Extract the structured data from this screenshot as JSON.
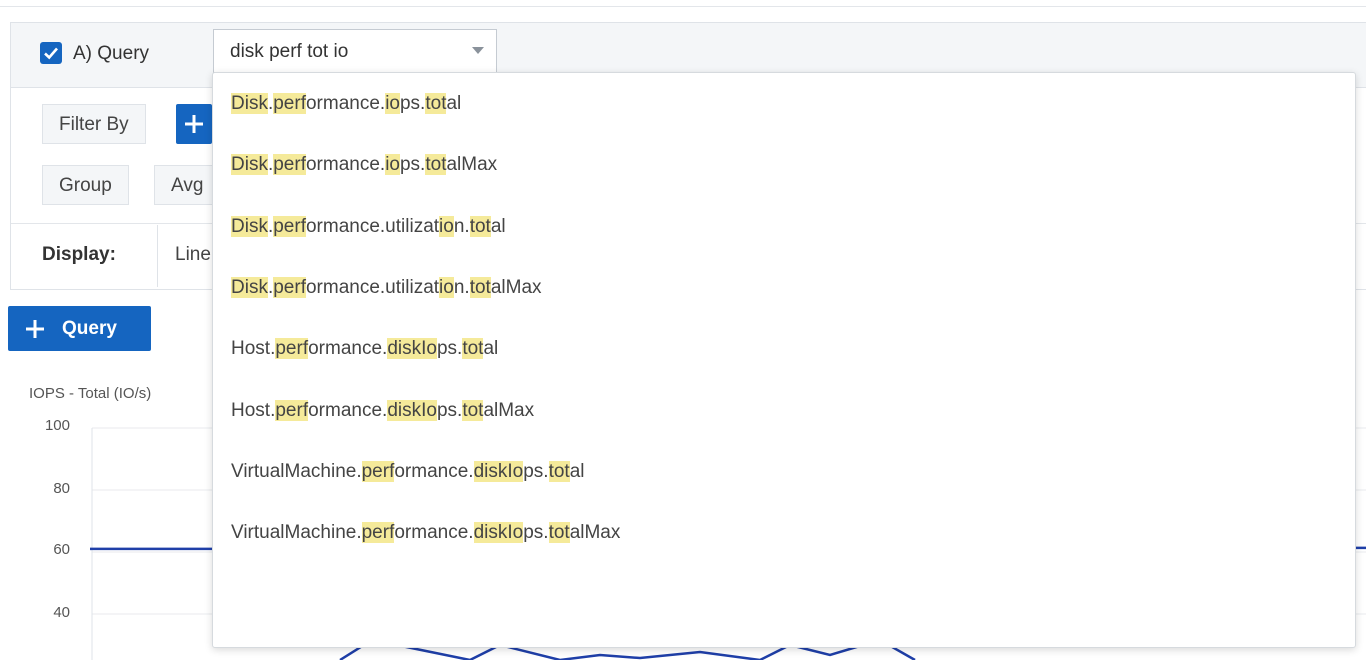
{
  "query": {
    "checked": true,
    "label": "A) Query",
    "select_value": "disk perf tot io"
  },
  "filter": {
    "label": "Filter By"
  },
  "group": {
    "label": "Group",
    "aggregation": "Avg"
  },
  "display": {
    "label": "Display:",
    "value": "Line"
  },
  "add_query_button": "Query",
  "chart": {
    "title": "IOPS - Total (IO/s)",
    "yticks": [
      "100",
      "80",
      "60",
      "40"
    ]
  },
  "chart_data": {
    "type": "line",
    "title": "IOPS - Total (IO/s)",
    "ylabel": "IOPS - Total (IO/s)",
    "ylim": [
      0,
      100
    ],
    "yticks": [
      100,
      80,
      60,
      40
    ],
    "series": [
      {
        "values": [
          61,
          61
        ]
      }
    ]
  },
  "dropdown": {
    "options": [
      {
        "segments": [
          [
            "Disk",
            1
          ],
          [
            ".",
            0
          ],
          [
            "perf",
            1
          ],
          [
            "ormance.",
            0
          ],
          [
            "io",
            1
          ],
          [
            "ps.",
            0
          ],
          [
            "tot",
            1
          ],
          [
            "al",
            0
          ]
        ]
      },
      {
        "segments": [
          [
            "Disk",
            1
          ],
          [
            ".",
            0
          ],
          [
            "perf",
            1
          ],
          [
            "ormance.",
            0
          ],
          [
            "io",
            1
          ],
          [
            "ps.",
            0
          ],
          [
            "tot",
            1
          ],
          [
            "alMax",
            0
          ]
        ]
      },
      {
        "segments": [
          [
            "Disk",
            1
          ],
          [
            ".",
            0
          ],
          [
            "perf",
            1
          ],
          [
            "ormance.utilizat",
            0
          ],
          [
            "io",
            1
          ],
          [
            "n.",
            0
          ],
          [
            "tot",
            1
          ],
          [
            "al",
            0
          ]
        ]
      },
      {
        "segments": [
          [
            "Disk",
            1
          ],
          [
            ".",
            0
          ],
          [
            "perf",
            1
          ],
          [
            "ormance.utilizat",
            0
          ],
          [
            "io",
            1
          ],
          [
            "n.",
            0
          ],
          [
            "tot",
            1
          ],
          [
            "alMax",
            0
          ]
        ]
      },
      {
        "segments": [
          [
            "Host.",
            0
          ],
          [
            "perf",
            1
          ],
          [
            "ormance.",
            0
          ],
          [
            "diskIo",
            1
          ],
          [
            "ps.",
            0
          ],
          [
            "tot",
            1
          ],
          [
            "al",
            0
          ]
        ]
      },
      {
        "segments": [
          [
            "Host.",
            0
          ],
          [
            "perf",
            1
          ],
          [
            "ormance.",
            0
          ],
          [
            "diskIo",
            1
          ],
          [
            "ps.",
            0
          ],
          [
            "tot",
            1
          ],
          [
            "alMax",
            0
          ]
        ]
      },
      {
        "segments": [
          [
            "VirtualMachine.",
            0
          ],
          [
            "perf",
            1
          ],
          [
            "ormance.",
            0
          ],
          [
            "diskIo",
            1
          ],
          [
            "ps.",
            0
          ],
          [
            "tot",
            1
          ],
          [
            "al",
            0
          ]
        ]
      },
      {
        "segments": [
          [
            "VirtualMachine.",
            0
          ],
          [
            "perf",
            1
          ],
          [
            "ormance.",
            0
          ],
          [
            "diskIo",
            1
          ],
          [
            "ps.",
            0
          ],
          [
            "tot",
            1
          ],
          [
            "alMax",
            0
          ]
        ]
      }
    ]
  },
  "colors": {
    "accent": "#1565c0",
    "highlight": "#f5ea9a",
    "series_line": "#1f3fa8"
  },
  "icons": {
    "checkbox": "check-icon",
    "select_caret": "chevron-down-icon",
    "add": "plus-icon"
  }
}
